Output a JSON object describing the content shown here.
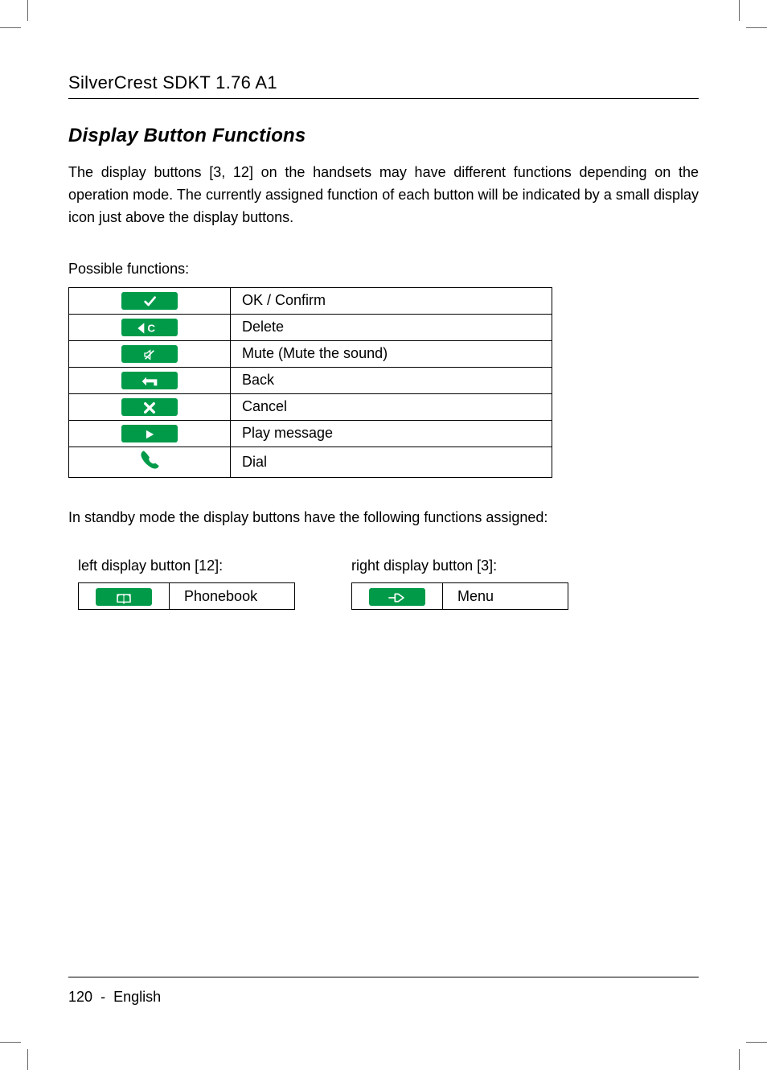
{
  "header": {
    "title": "SilverCrest SDKT 1.76 A1"
  },
  "section": {
    "title": "Display Button Functions"
  },
  "intro": "The display buttons [3, 12] on the handsets may have different functions depending on the operation mode. The currently assigned function of each button will be indicated by a small display icon just above the display buttons.",
  "possible_label": "Possible functions:",
  "functions": [
    {
      "icon": "check-icon",
      "label": "OK / Confirm"
    },
    {
      "icon": "delete-icon",
      "label": "Delete"
    },
    {
      "icon": "mute-icon",
      "label": "Mute (Mute the sound)"
    },
    {
      "icon": "back-icon",
      "label": "Back"
    },
    {
      "icon": "cancel-icon",
      "label": "Cancel"
    },
    {
      "icon": "play-icon",
      "label": "Play message"
    },
    {
      "icon": "dial-icon",
      "label": "Dial"
    }
  ],
  "standby_intro": "In standby mode the display buttons have the following functions assigned:",
  "standby": {
    "left": {
      "caption": "left display button [12]:",
      "icon": "phonebook-icon",
      "label": "Phonebook"
    },
    "right": {
      "caption": "right display button [3]:",
      "icon": "menu-icon",
      "label": "Menu"
    }
  },
  "footer": {
    "page": "120",
    "sep": "-",
    "lang": "English"
  }
}
